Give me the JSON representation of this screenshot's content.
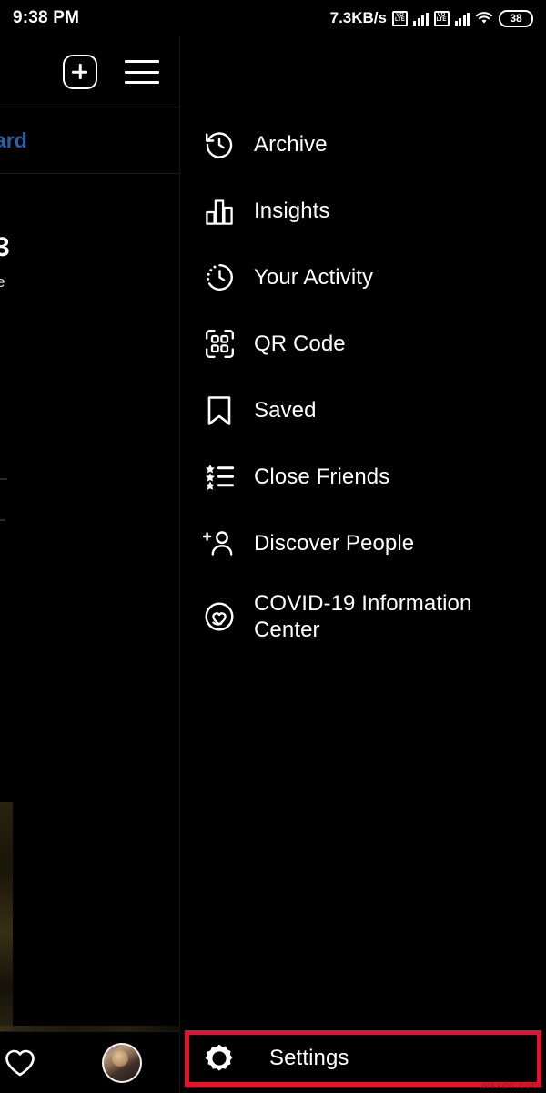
{
  "status_bar": {
    "time": "9:38 PM",
    "network_speed": "7.3KB/s",
    "volte_label_top": "VO",
    "volte_label_bottom": "LTE",
    "battery_percent": "38",
    "icons": [
      "volte-icon",
      "signal-bars-icon",
      "wifi-icon",
      "battery-icon"
    ]
  },
  "toolbar": {
    "add_label": "add-post",
    "menu_label": "hamburger-menu"
  },
  "background": {
    "tab_label_partial": "ard",
    "stat_number_partial": "3",
    "stat_label_partial": "e",
    "fragment_partial": ")",
    "tab_color": "#2a5fa8"
  },
  "drawer": {
    "items": [
      {
        "label": "Archive",
        "icon": "archive-clock-icon"
      },
      {
        "label": "Insights",
        "icon": "bar-chart-icon"
      },
      {
        "label": "Your Activity",
        "icon": "activity-clock-icon"
      },
      {
        "label": "QR Code",
        "icon": "qr-code-icon"
      },
      {
        "label": "Saved",
        "icon": "bookmark-icon"
      },
      {
        "label": "Close Friends",
        "icon": "star-list-icon"
      },
      {
        "label": "Discover People",
        "icon": "person-add-icon"
      },
      {
        "label": "COVID-19 Information Center",
        "icon": "covid-heart-icon"
      }
    ],
    "settings": {
      "label": "Settings",
      "icon": "gear-icon",
      "highlight_color": "#e8112d"
    }
  },
  "bottom_nav": {
    "heart_icon": "heart-icon",
    "avatar": "profile-avatar"
  },
  "watermark": {
    "text": "wsxdn.com"
  }
}
